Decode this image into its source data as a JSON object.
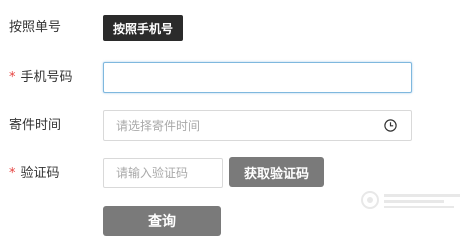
{
  "query_mode": {
    "label": "按照单号",
    "button_label": "按照手机号"
  },
  "phone": {
    "required_mark": "*",
    "label": "手机号码",
    "value": ""
  },
  "send_time": {
    "label": "寄件时间",
    "placeholder": "请选择寄件时间",
    "icon": "clock-icon"
  },
  "verification": {
    "required_mark": "*",
    "label": "验证码",
    "placeholder": "请输入验证码",
    "get_code_label": "获取验证码"
  },
  "submit": {
    "label": "查询"
  },
  "colors": {
    "required": "#e64340",
    "dark_button": "#2b2b2b",
    "gray_button": "#7a7a7a",
    "focus_border": "#7fb8de"
  }
}
